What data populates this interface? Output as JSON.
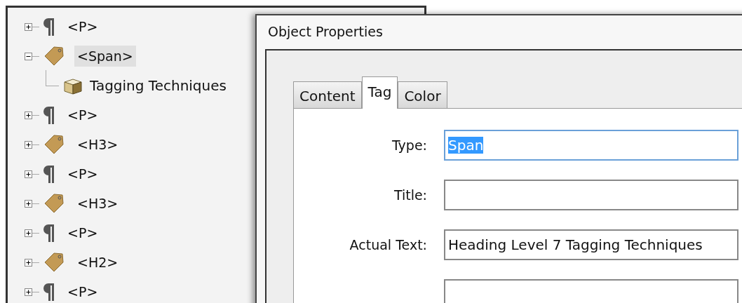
{
  "tree": [
    {
      "kind": "paragraph",
      "label": "<P>",
      "expanded": false,
      "selected": false
    },
    {
      "kind": "tag",
      "label": "<Span>",
      "expanded": true,
      "selected": true,
      "children": [
        {
          "kind": "content",
          "label": "Tagging Techniques",
          "selected": false
        }
      ]
    },
    {
      "kind": "paragraph",
      "label": "<P>",
      "expanded": false,
      "selected": false
    },
    {
      "kind": "tag",
      "label": "<H3>",
      "expanded": false,
      "selected": false
    },
    {
      "kind": "paragraph",
      "label": "<P>",
      "expanded": false,
      "selected": false
    },
    {
      "kind": "tag",
      "label": "<H3>",
      "expanded": false,
      "selected": false
    },
    {
      "kind": "paragraph",
      "label": "<P>",
      "expanded": false,
      "selected": false
    },
    {
      "kind": "tag",
      "label": "<H2>",
      "expanded": false,
      "selected": false
    },
    {
      "kind": "paragraph",
      "label": "<P>",
      "expanded": false,
      "selected": false
    }
  ],
  "dialog": {
    "title": "Object Properties",
    "tabs": [
      {
        "label": "Content",
        "selected": false
      },
      {
        "label": "Tag",
        "selected": true
      },
      {
        "label": "Color",
        "selected": false
      }
    ],
    "fields": [
      {
        "label": "Type:",
        "value": "Span",
        "highlighted": true
      },
      {
        "label": "Title:",
        "highlighted": false
      },
      {
        "label": "Actual Text:",
        "value": "Heading Level 7 Tagging Techniques",
        "highlighted": false
      },
      {
        "highlighted": false
      }
    ]
  }
}
